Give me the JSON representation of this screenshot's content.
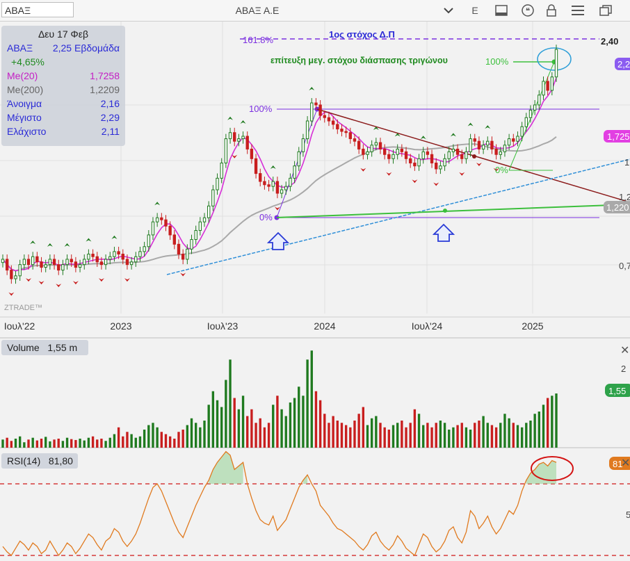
{
  "window": {
    "symbol_input": "ΑΒΑΞ",
    "title": "ΑΒΑΞ Α.Ε",
    "period_label": "E",
    "icons": [
      "chevron-down-icon",
      "layout-icon",
      "quote-icon",
      "lock-icon",
      "menu-icon",
      "window-icon"
    ]
  },
  "info": {
    "date": "Δευ 17 Φεβ",
    "symbol": "ΑΒΑΞ",
    "price_period": "2,25 Εβδομάδα",
    "change": "+4,65%",
    "ma20_label": "Me(20)",
    "ma20_value": "1,7258",
    "ma200_label": "Me(200)",
    "ma200_value": "1,2209",
    "open_label": "Άνοιγμα",
    "open_value": "2,16",
    "high_label": "Μέγιστο",
    "high_value": "2,29",
    "low_label": "Ελάχιστο",
    "low_value": "2,11"
  },
  "colors": {
    "up": "#1f7a1f",
    "down": "#c81e1e",
    "ma20": "#d62fd6",
    "ma200": "#a9a9a9",
    "trend_blue": "#2f8fd8",
    "fib_purple": "#7b2fe0",
    "resistance": "#8b1a1a",
    "support_green": "#3cbf3c",
    "rsi_line": "#e07a1f",
    "overbought": "#d43a3a"
  },
  "annotations": {
    "target_title": "1ος στόχος Δ.Π",
    "fib_1618": "161.8%",
    "target_price": "2,40",
    "achieved_text": "επίτευξη μεγ. στόχου διάσπασης τριγώνου",
    "pct_100_right": "100%",
    "pct_100_left": "100%",
    "pct_0_left": "0%",
    "pct_0_right": "0%",
    "watermark": "ZTRADE™"
  },
  "price_tags": [
    "2,2",
    "1,725",
    "1,220"
  ],
  "axis_edge_labels": [
    "1",
    "1,2",
    "0,7"
  ],
  "volume": {
    "label": "Volume",
    "value": "1,55 m",
    "tag": "1,55",
    "axis_label": "2"
  },
  "rsi": {
    "label": "RSI(14)",
    "value": "81,80",
    "tag": "81",
    "axis_label": "5"
  },
  "chart_data": {
    "type": "candlestick",
    "x_ticks": [
      "Ιουλ'22",
      "2023",
      "Ιουλ'23",
      "2024",
      "Ιουλ'24",
      "2025"
    ],
    "series": [
      {
        "name": "ΑΒΑΞ",
        "closes": [
          0.62,
          0.58,
          0.55,
          0.56,
          0.6,
          0.62,
          0.6,
          0.63,
          0.61,
          0.59,
          0.6,
          0.62,
          0.6,
          0.58,
          0.6,
          0.62,
          0.61,
          0.59,
          0.6,
          0.62,
          0.64,
          0.63,
          0.61,
          0.6,
          0.62,
          0.63,
          0.65,
          0.64,
          0.62,
          0.6,
          0.61,
          0.63,
          0.65,
          0.67,
          0.72,
          0.78,
          0.8,
          0.79,
          0.76,
          0.72,
          0.68,
          0.64,
          0.62,
          0.66,
          0.7,
          0.74,
          0.78,
          0.8,
          0.86,
          0.95,
          1.02,
          1.12,
          1.3,
          1.35,
          1.28,
          1.3,
          1.32,
          1.22,
          1.15,
          1.05,
          1.0,
          0.98,
          0.97,
          1.0,
          0.93,
          0.95,
          0.97,
          1.02,
          1.1,
          1.2,
          1.3,
          1.45,
          1.62,
          1.6,
          1.5,
          1.48,
          1.45,
          1.42,
          1.38,
          1.36,
          1.35,
          1.3,
          1.28,
          1.22,
          1.18,
          1.2,
          1.25,
          1.27,
          1.22,
          1.18,
          1.15,
          1.18,
          1.22,
          1.2,
          1.15,
          1.12,
          1.1,
          1.15,
          1.2,
          1.18,
          1.12,
          1.08,
          1.1,
          1.15,
          1.2,
          1.22,
          1.18,
          1.15,
          1.2,
          1.3,
          1.28,
          1.22,
          1.25,
          1.28,
          1.22,
          1.18,
          1.2,
          1.25,
          1.3,
          1.28,
          1.32,
          1.4,
          1.48,
          1.55,
          1.6,
          1.7,
          1.85,
          1.75,
          1.9,
          2.25
        ]
      },
      {
        "name": "Me(20)",
        "value_last": 1.7258
      },
      {
        "name": "Me(200)",
        "value_last": 1.2209
      }
    ],
    "volume_values": [
      0.18,
      0.22,
      0.15,
      0.2,
      0.25,
      0.12,
      0.18,
      0.22,
      0.16,
      0.2,
      0.24,
      0.14,
      0.18,
      0.2,
      0.15,
      0.22,
      0.19,
      0.17,
      0.2,
      0.16,
      0.22,
      0.25,
      0.18,
      0.2,
      0.15,
      0.22,
      0.3,
      0.45,
      0.25,
      0.35,
      0.3,
      0.22,
      0.25,
      0.4,
      0.5,
      0.55,
      0.45,
      0.35,
      0.3,
      0.25,
      0.2,
      0.35,
      0.4,
      0.5,
      0.65,
      0.55,
      0.45,
      0.6,
      0.95,
      1.25,
      1.05,
      0.9,
      1.5,
      1.95,
      1.1,
      0.85,
      1.15,
      0.7,
      0.85,
      0.55,
      0.65,
      0.45,
      0.55,
      0.95,
      1.15,
      0.85,
      0.7,
      1.0,
      1.1,
      1.35,
      1.15,
      1.95,
      2.15,
      1.25,
      1.05,
      0.75,
      0.55,
      0.7,
      0.6,
      0.55,
      0.5,
      0.45,
      0.6,
      0.75,
      0.9,
      0.5,
      0.65,
      0.7,
      0.55,
      0.45,
      0.4,
      0.5,
      0.55,
      0.6,
      0.45,
      0.55,
      0.85,
      0.75,
      0.5,
      0.55,
      0.45,
      0.55,
      0.6,
      0.55,
      0.4,
      0.45,
      0.5,
      0.55,
      0.45,
      0.4,
      0.55,
      0.6,
      0.7,
      0.55,
      0.5,
      0.45,
      0.55,
      0.75,
      0.65,
      0.55,
      0.5,
      0.45,
      0.55,
      0.6,
      0.75,
      0.8,
      0.95,
      1.1,
      1.15,
      1.2,
      0.95,
      1.75,
      1.55
    ],
    "rsi_values": [
      35,
      32,
      30,
      34,
      38,
      36,
      33,
      37,
      35,
      31,
      33,
      38,
      34,
      30,
      33,
      37,
      35,
      31,
      34,
      38,
      42,
      40,
      36,
      33,
      38,
      40,
      45,
      43,
      38,
      35,
      38,
      42,
      48,
      55,
      62,
      68,
      70,
      66,
      60,
      54,
      48,
      43,
      40,
      46,
      52,
      58,
      63,
      68,
      72,
      78,
      82,
      85,
      88,
      86,
      78,
      80,
      82,
      70,
      62,
      55,
      50,
      48,
      47,
      52,
      44,
      47,
      50,
      56,
      62,
      68,
      72,
      75,
      70,
      66,
      58,
      55,
      52,
      48,
      45,
      44,
      42,
      40,
      38,
      35,
      33,
      36,
      41,
      43,
      38,
      35,
      33,
      36,
      41,
      38,
      34,
      32,
      30,
      36,
      42,
      40,
      35,
      32,
      34,
      38,
      44,
      46,
      40,
      37,
      43,
      55,
      52,
      45,
      48,
      52,
      46,
      42,
      45,
      50,
      55,
      53,
      58,
      66,
      72,
      76,
      78,
      81,
      82,
      80,
      83,
      82
    ],
    "rsi_overbought": 70,
    "rsi_oversold": 30,
    "price_axis_labels": [
      "2,40",
      "1",
      "1,2",
      "0,7"
    ]
  }
}
